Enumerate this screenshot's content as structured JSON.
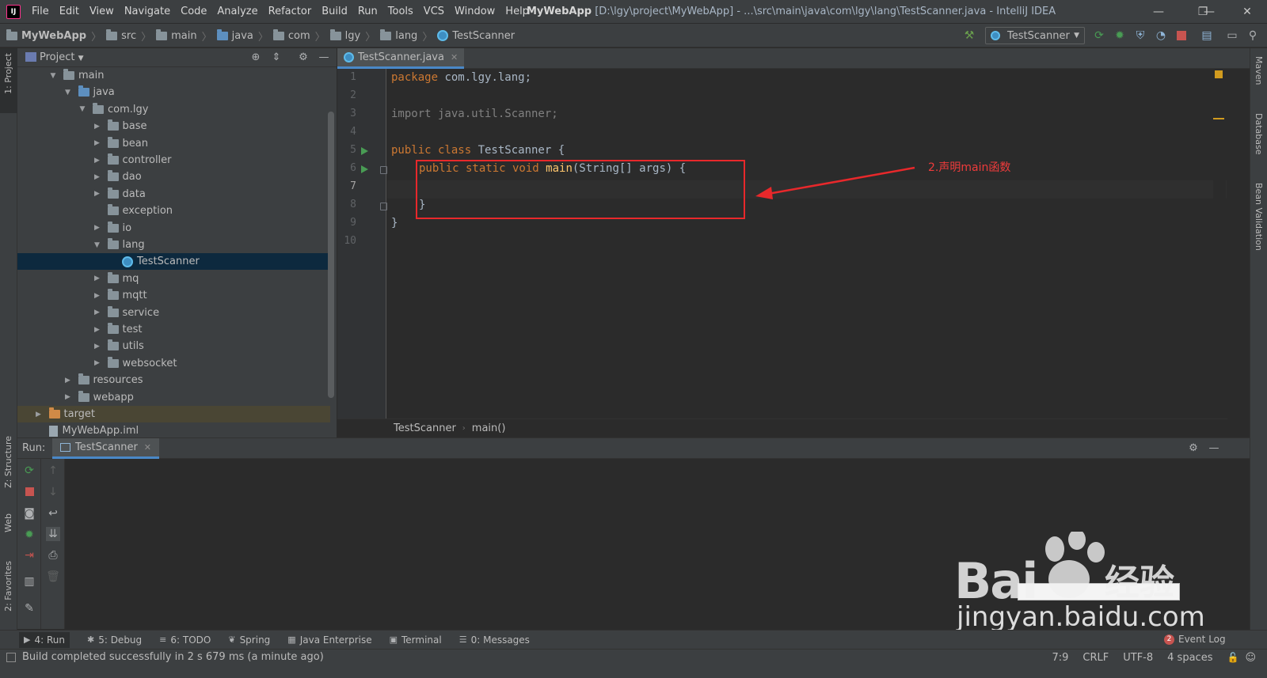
{
  "window": {
    "menu": [
      "File",
      "Edit",
      "View",
      "Navigate",
      "Code",
      "Analyze",
      "Refactor",
      "Build",
      "Run",
      "Tools",
      "VCS",
      "Window",
      "Help"
    ],
    "project_name": "MyWebApp",
    "title_rest": " [D:\\lgy\\project\\MyWebApp] - ...\\src\\main\\java\\com\\lgy\\lang\\TestScanner.java - IntelliJ IDEA",
    "minimize": "—",
    "restore": "❐",
    "close": "✕"
  },
  "breadcrumbs": [
    "MyWebApp",
    "src",
    "main",
    "java",
    "com",
    "lgy",
    "lang",
    "TestScanner"
  ],
  "toolbar": {
    "run_config": "TestScanner"
  },
  "stripes": {
    "left_top": "1: Project",
    "left_structure": "Z: Structure",
    "left_web": "Web",
    "left_favorites": "2: Favorites",
    "right_maven": "Maven",
    "right_database": "Database",
    "right_bean": "Bean Validation"
  },
  "project": {
    "title": "Project",
    "tree": [
      {
        "label": "main",
        "depth": 0,
        "arrow": "open",
        "icon": "folder"
      },
      {
        "label": "java",
        "depth": 1,
        "arrow": "open",
        "icon": "folder-blue"
      },
      {
        "label": "com.lgy",
        "depth": 2,
        "arrow": "open",
        "icon": "folder"
      },
      {
        "label": "base",
        "depth": 3,
        "arrow": "closed",
        "icon": "folder"
      },
      {
        "label": "bean",
        "depth": 3,
        "arrow": "closed",
        "icon": "folder"
      },
      {
        "label": "controller",
        "depth": 3,
        "arrow": "closed",
        "icon": "folder"
      },
      {
        "label": "dao",
        "depth": 3,
        "arrow": "closed",
        "icon": "folder"
      },
      {
        "label": "data",
        "depth": 3,
        "arrow": "closed",
        "icon": "folder"
      },
      {
        "label": "exception",
        "depth": 3,
        "arrow": "none",
        "icon": "folder"
      },
      {
        "label": "io",
        "depth": 3,
        "arrow": "closed",
        "icon": "folder"
      },
      {
        "label": "lang",
        "depth": 3,
        "arrow": "open",
        "icon": "folder"
      },
      {
        "label": "TestScanner",
        "depth": 4,
        "arrow": "none",
        "icon": "class",
        "selected": true
      },
      {
        "label": "mq",
        "depth": 3,
        "arrow": "closed",
        "icon": "folder"
      },
      {
        "label": "mqtt",
        "depth": 3,
        "arrow": "closed",
        "icon": "folder"
      },
      {
        "label": "service",
        "depth": 3,
        "arrow": "closed",
        "icon": "folder"
      },
      {
        "label": "test",
        "depth": 3,
        "arrow": "closed",
        "icon": "folder"
      },
      {
        "label": "utils",
        "depth": 3,
        "arrow": "closed",
        "icon": "folder"
      },
      {
        "label": "websocket",
        "depth": 3,
        "arrow": "closed",
        "icon": "folder"
      },
      {
        "label": "resources",
        "depth": 1,
        "arrow": "closed",
        "icon": "folder"
      },
      {
        "label": "webapp",
        "depth": 1,
        "arrow": "closed",
        "icon": "folder"
      },
      {
        "label": "target",
        "depth": -1,
        "arrow": "closed",
        "icon": "folder-orange",
        "excluded": true
      },
      {
        "label": "MyWebApp.iml",
        "depth": -1,
        "arrow": "none",
        "icon": "file"
      }
    ]
  },
  "editor": {
    "tab_label": "TestScanner.java",
    "line_numbers": [
      "1",
      "2",
      "3",
      "4",
      "5",
      "6",
      "7",
      "8",
      "9",
      "10"
    ],
    "code": {
      "l1_kw": "package ",
      "l1_rest": "com.lgy.lang;",
      "l3": "import java.util.Scanner;",
      "l5_kw": "public class ",
      "l5_rest": "TestScanner {",
      "l6_kw": "public static void ",
      "l6_fn": "main",
      "l6_rest": "(String[] args) {",
      "l8": "}",
      "l9": "}"
    },
    "breadcrumb_class": "TestScanner",
    "breadcrumb_method": "main()"
  },
  "annotation": {
    "text": "2.声明main函数",
    "color": "#e8282b"
  },
  "run_panel": {
    "label": "Run:",
    "tab_label": "TestScanner"
  },
  "tool_tabs": [
    {
      "label": "4: Run",
      "icon": "▶"
    },
    {
      "label": "5: Debug",
      "icon": "✱"
    },
    {
      "label": "6: TODO",
      "icon": "≡"
    },
    {
      "label": "Spring",
      "icon": "❦"
    },
    {
      "label": "Java Enterprise",
      "icon": "▦"
    },
    {
      "label": "Terminal",
      "icon": "▣"
    },
    {
      "label": "0: Messages",
      "icon": "☰"
    }
  ],
  "event_log": {
    "count": "2",
    "label": "Event Log"
  },
  "status": {
    "message": "Build completed successfully in 2 s 679 ms (a minute ago)",
    "position": "7:9",
    "line_sep": "CRLF",
    "encoding": "UTF-8",
    "indent": "4 spaces"
  },
  "watermark": {
    "logo": "Bai",
    "logo_cn": "经验",
    "url": "jingyan.baidu.com"
  },
  "colors": {
    "accent": "#4a88c7",
    "run_green": "#499c54",
    "stop_red": "#c75450"
  }
}
